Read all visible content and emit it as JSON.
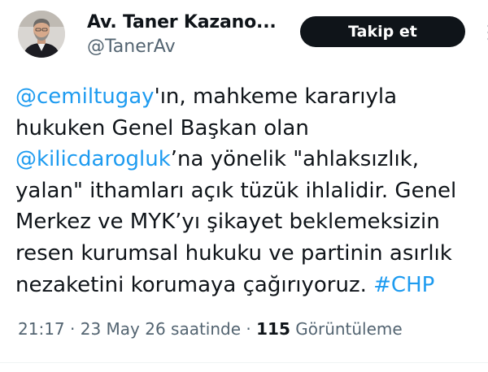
{
  "author": {
    "display_name": "Av. Taner Kazano...",
    "handle": "@TanerAv",
    "avatar_icon": "profile-photo"
  },
  "follow_button": {
    "label": "Takip et"
  },
  "tweet": {
    "lines": [
      [
        {
          "text": "@cemiltugay",
          "type": "mention"
        },
        {
          "text": "'ın, mahkeme kararıyla",
          "type": "text"
        }
      ],
      [
        {
          "text": "hukuken Genel Başkan olan",
          "type": "text"
        }
      ],
      [
        {
          "text": "@kilicdarogluk",
          "type": "mention"
        },
        {
          "text": "’na yönelik \"ahlaksızlık,",
          "type": "text"
        }
      ],
      [
        {
          "text": "yalan\" ithamları açık tüzük ihlalidir. Genel",
          "type": "text"
        }
      ],
      [
        {
          "text": "Merkez ve MYK’yı şikayet beklemeksizin",
          "type": "text"
        }
      ],
      [
        {
          "text": "resen kurumsal hukuku ve partinin asırlık",
          "type": "text"
        }
      ],
      [
        {
          "text": "nezaketini korumaya çağırıyoruz. ",
          "type": "text"
        },
        {
          "text": "#CHP",
          "type": "hashtag"
        }
      ]
    ]
  },
  "meta": {
    "time": "21:17",
    "separator": " · ",
    "date": "23 May 26 saatinde",
    "views_count": "115",
    "views_label": "Görüntüleme"
  },
  "colors": {
    "link": "#1d9bf0",
    "text": "#0f1419",
    "secondary": "#536471",
    "button_bg": "#0f1419"
  }
}
